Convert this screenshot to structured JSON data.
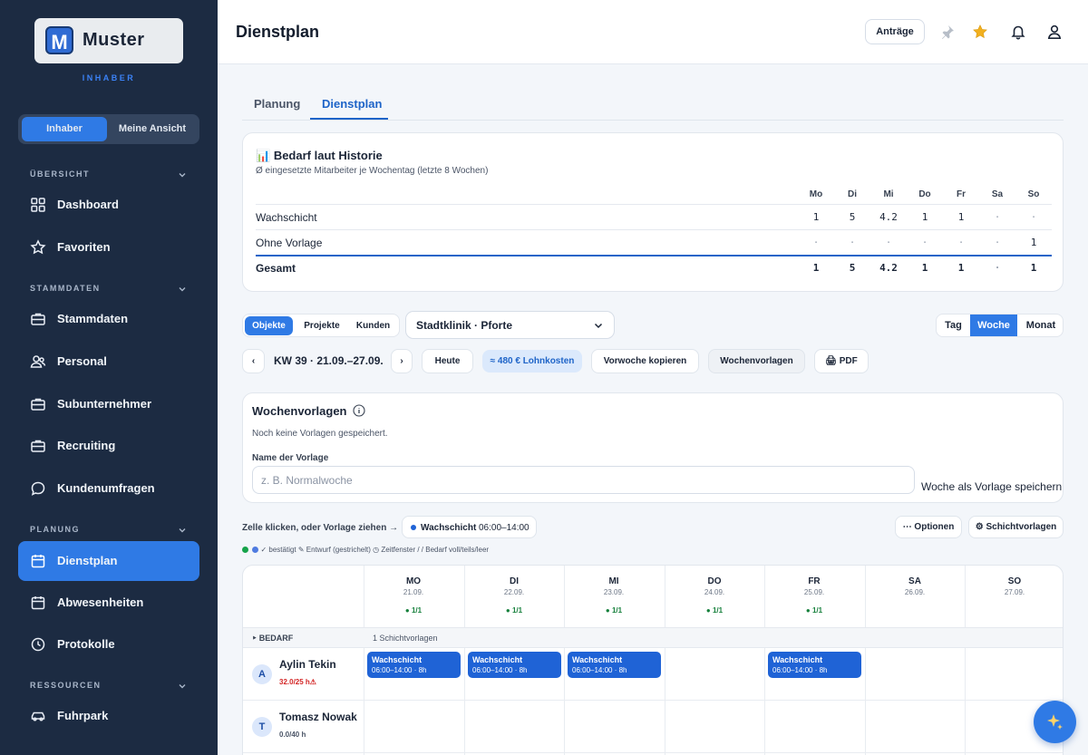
{
  "brand": {
    "logo_text": "Muster",
    "logo_mark": "M",
    "role": "INHABER"
  },
  "view_toggle": {
    "owner": "Inhaber",
    "mine": "Meine Ansicht"
  },
  "sidebar": {
    "sections": [
      {
        "label": "ÜBERSICHT"
      },
      {
        "label": "STAMMDATEN"
      },
      {
        "label": "PLANUNG"
      },
      {
        "label": "RESSOURCEN"
      }
    ],
    "items": [
      {
        "label": "Dashboard",
        "icon": "grid-icon"
      },
      {
        "label": "Favoriten",
        "icon": "star-icon"
      },
      {
        "label": "Stammdaten",
        "icon": "briefcase-icon"
      },
      {
        "label": "Personal",
        "icon": "users-icon"
      },
      {
        "label": "Subunternehmer",
        "icon": "briefcase-icon"
      },
      {
        "label": "Recruiting",
        "icon": "briefcase-icon"
      },
      {
        "label": "Kundenumfragen",
        "icon": "chat-icon"
      },
      {
        "label": "Dienstplan",
        "icon": "calendar-icon",
        "active": true
      },
      {
        "label": "Abwesenheiten",
        "icon": "calendar-icon"
      },
      {
        "label": "Protokolle",
        "icon": "clock-icon"
      },
      {
        "label": "Fuhrpark",
        "icon": "car-icon"
      }
    ]
  },
  "header": {
    "title": "Dienstplan",
    "requests_label": "Anträge",
    "icons": [
      "pin-icon",
      "star-icon",
      "bell-icon",
      "user-icon"
    ]
  },
  "tabs": [
    {
      "label": "Planung"
    },
    {
      "label": "Dienstplan",
      "active": true
    }
  ],
  "demand": {
    "icon": "📊",
    "title": "Bedarf laut Historie",
    "subtitle": "Ø eingesetzte Mitarbeiter je Wochentag (letzte 8 Wochen)",
    "days": [
      "Mo",
      "Di",
      "Mi",
      "Do",
      "Fr",
      "Sa",
      "So"
    ],
    "rows": [
      {
        "label": "Wachschicht",
        "values": [
          "1",
          "5",
          "4.2",
          "1",
          "1",
          "·",
          "·"
        ]
      },
      {
        "label": "Ohne Vorlage",
        "values": [
          "·",
          "·",
          "·",
          "·",
          "·",
          "·",
          "1"
        ]
      }
    ],
    "total": {
      "label": "Gesamt",
      "values": [
        "1",
        "5",
        "4.2",
        "1",
        "1",
        "·",
        "1"
      ]
    }
  },
  "filter": {
    "scopes": [
      "Objekte",
      "Projekte",
      "Kunden"
    ],
    "selected_object": "Stadtklinik · Pforte",
    "ranges": [
      "Tag",
      "Woche",
      "Monat"
    ],
    "active_range": "Woche"
  },
  "week_nav": {
    "prev": "‹",
    "next": "›",
    "label": "KW 39 · 21.09.–27.09.",
    "today": "Heute",
    "cost": "≈ 480 € Lohnkosten",
    "copy": "Vorwoche kopieren",
    "templates": "Wochenvorlagen",
    "pdf": "🖨 PDF"
  },
  "week_templates": {
    "title": "Wochenvorlagen",
    "info_icon": "info-icon",
    "empty": "Noch keine Vorlagen gespeichert.",
    "name_label": "Name der Vorlage",
    "name_placeholder": "z. B. Normalwoche",
    "name_value": "",
    "save_label": "Woche als Vorlage speichern"
  },
  "schedule": {
    "hint": "Zelle klicken, oder Vorlage ziehen →",
    "active_shift": {
      "name": "Wachschicht",
      "time": "06:00–14:00",
      "color": "#1f63d6"
    },
    "options": "⋯ Optionen",
    "shift_templates": "⚙ Schichtvorlagen",
    "legend": "✓ bestätigt   ✎ Entwurf (gestrichelt)   ◷ Zeitfenster   / /  Bedarf voll/teils/leer",
    "days": [
      {
        "name": "MO",
        "date": "21.09.",
        "quota": "● 1/1"
      },
      {
        "name": "DI",
        "date": "22.09.",
        "quota": "● 1/1"
      },
      {
        "name": "MI",
        "date": "23.09.",
        "quota": "● 1/1"
      },
      {
        "name": "DO",
        "date": "24.09.",
        "quota": "● 1/1"
      },
      {
        "name": "FR",
        "date": "25.09.",
        "quota": "● 1/1"
      },
      {
        "name": "SA",
        "date": "26.09.",
        "quota": ""
      },
      {
        "name": "SO",
        "date": "27.09.",
        "quota": ""
      }
    ],
    "demand_row": {
      "label": "‣ BEDARF",
      "info": "1 Schichtvorlagen"
    },
    "employees": [
      {
        "initial": "A",
        "name": "Aylin Tekin",
        "hours": "32.0/25 h⚠",
        "over": true,
        "shifts": [
          {
            "day": 0,
            "name": "Wachschicht",
            "detail": "06:00–14:00 · 8h"
          },
          {
            "day": 1,
            "name": "Wachschicht",
            "detail": "06:00–14:00 · 8h"
          },
          {
            "day": 2,
            "name": "Wachschicht",
            "detail": "06:00–14:00 · 8h"
          },
          {
            "day": 4,
            "name": "Wachschicht",
            "detail": "06:00–14:00 · 8h"
          }
        ]
      },
      {
        "initial": "T",
        "name": "Tomasz Nowak",
        "hours": "0.0/40 h",
        "over": false,
        "shifts": []
      }
    ]
  },
  "colors": {
    "sidebar": "#1c2b42",
    "accent": "#2f7ae5",
    "shift": "#1f63d6",
    "warn": "#d32626",
    "ok": "#16803c"
  },
  "fab_icon": "sparkle-icon"
}
